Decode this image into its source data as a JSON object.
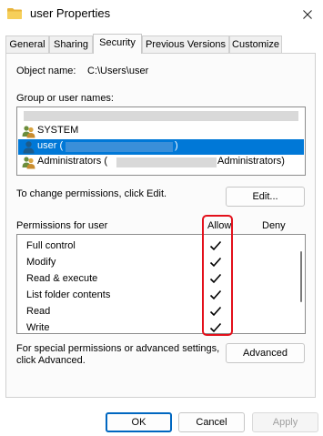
{
  "window": {
    "title": "user Properties",
    "icon": "folder-icon",
    "close_icon": "close-icon"
  },
  "tabs": [
    {
      "label": "General",
      "active": false
    },
    {
      "label": "Sharing",
      "active": false
    },
    {
      "label": "Security",
      "active": true
    },
    {
      "label": "Previous Versions",
      "active": false
    },
    {
      "label": "Customize",
      "active": false
    }
  ],
  "security": {
    "object_name_label": "Object name:",
    "object_name_value": "C:\\Users\\user",
    "group_label": "Group or user names:",
    "groups": [
      {
        "label": "",
        "selected": false,
        "icon": "none"
      },
      {
        "label": "SYSTEM",
        "selected": false,
        "icon": "group-users-icon"
      },
      {
        "label": "user (",
        "label_end": ")",
        "selected": true,
        "icon": "user-icon"
      },
      {
        "label": "Administrators (",
        "label_end": "Administrators)",
        "selected": false,
        "icon": "group-users-icon"
      }
    ],
    "change_text": "To change permissions, click Edit.",
    "edit_button": "Edit...",
    "permissions_label": "Permissions for user",
    "allow_header": "Allow",
    "deny_header": "Deny",
    "permissions": [
      {
        "name": "Full control",
        "allow": true,
        "deny": false
      },
      {
        "name": "Modify",
        "allow": true,
        "deny": false
      },
      {
        "name": "Read & execute",
        "allow": true,
        "deny": false
      },
      {
        "name": "List folder contents",
        "allow": true,
        "deny": false
      },
      {
        "name": "Read",
        "allow": true,
        "deny": false
      },
      {
        "name": "Write",
        "allow": true,
        "deny": false
      }
    ],
    "special_text_line1": "For special permissions or advanced settings,",
    "special_text_line2": "click Advanced.",
    "advanced_button": "Advanced"
  },
  "footer": {
    "ok": "OK",
    "cancel": "Cancel",
    "apply": "Apply"
  },
  "colors": {
    "selection": "#0078d7",
    "highlight_box": "#e3101b",
    "primary_button_border": "#0067c0"
  }
}
